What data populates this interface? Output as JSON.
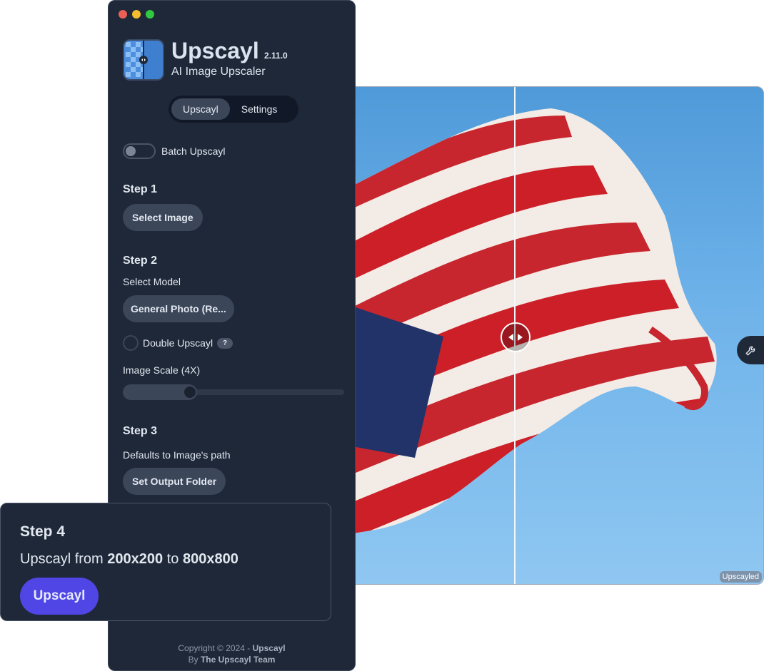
{
  "window": {
    "traffic_lights": [
      "#ec5f57",
      "#f4bc2f",
      "#2fc840"
    ]
  },
  "header": {
    "title": "Upscayl",
    "version": "2.11.0",
    "subtitle": "AI Image Upscaler"
  },
  "tabs": [
    {
      "label": "Upscayl",
      "active": true
    },
    {
      "label": "Settings",
      "active": false
    }
  ],
  "batch": {
    "label": "Batch Upscayl",
    "enabled": false
  },
  "step1": {
    "title": "Step 1",
    "button": "Select Image"
  },
  "step2": {
    "title": "Step 2",
    "model_label": "Select Model",
    "model_value": "General Photo (Re...",
    "double_label": "Double Upscayl",
    "double_help": "?",
    "double_checked": false,
    "scale_label": "Image Scale (4X)",
    "scale_value": 4
  },
  "step3": {
    "title": "Step 3",
    "description": "Defaults to Image's path",
    "button": "Set Output Folder"
  },
  "step4": {
    "title": "Step 4",
    "prefix": "Upscayl from",
    "from_size": "200x200",
    "connector": "to",
    "to_size": "800x800",
    "button": "Upscayl"
  },
  "footer": {
    "copyright": "Copyright © 2024 -",
    "brand": "Upscayl",
    "by": "By",
    "team": "The Upscayl Team"
  },
  "viewer": {
    "badge": "Upscayled",
    "icons": {
      "handle": "compare-arrows-icon",
      "tools": "wrench-icon"
    }
  },
  "colors": {
    "accent": "#4f46e5",
    "panel": "#1f2838",
    "button": "#3b4659"
  }
}
